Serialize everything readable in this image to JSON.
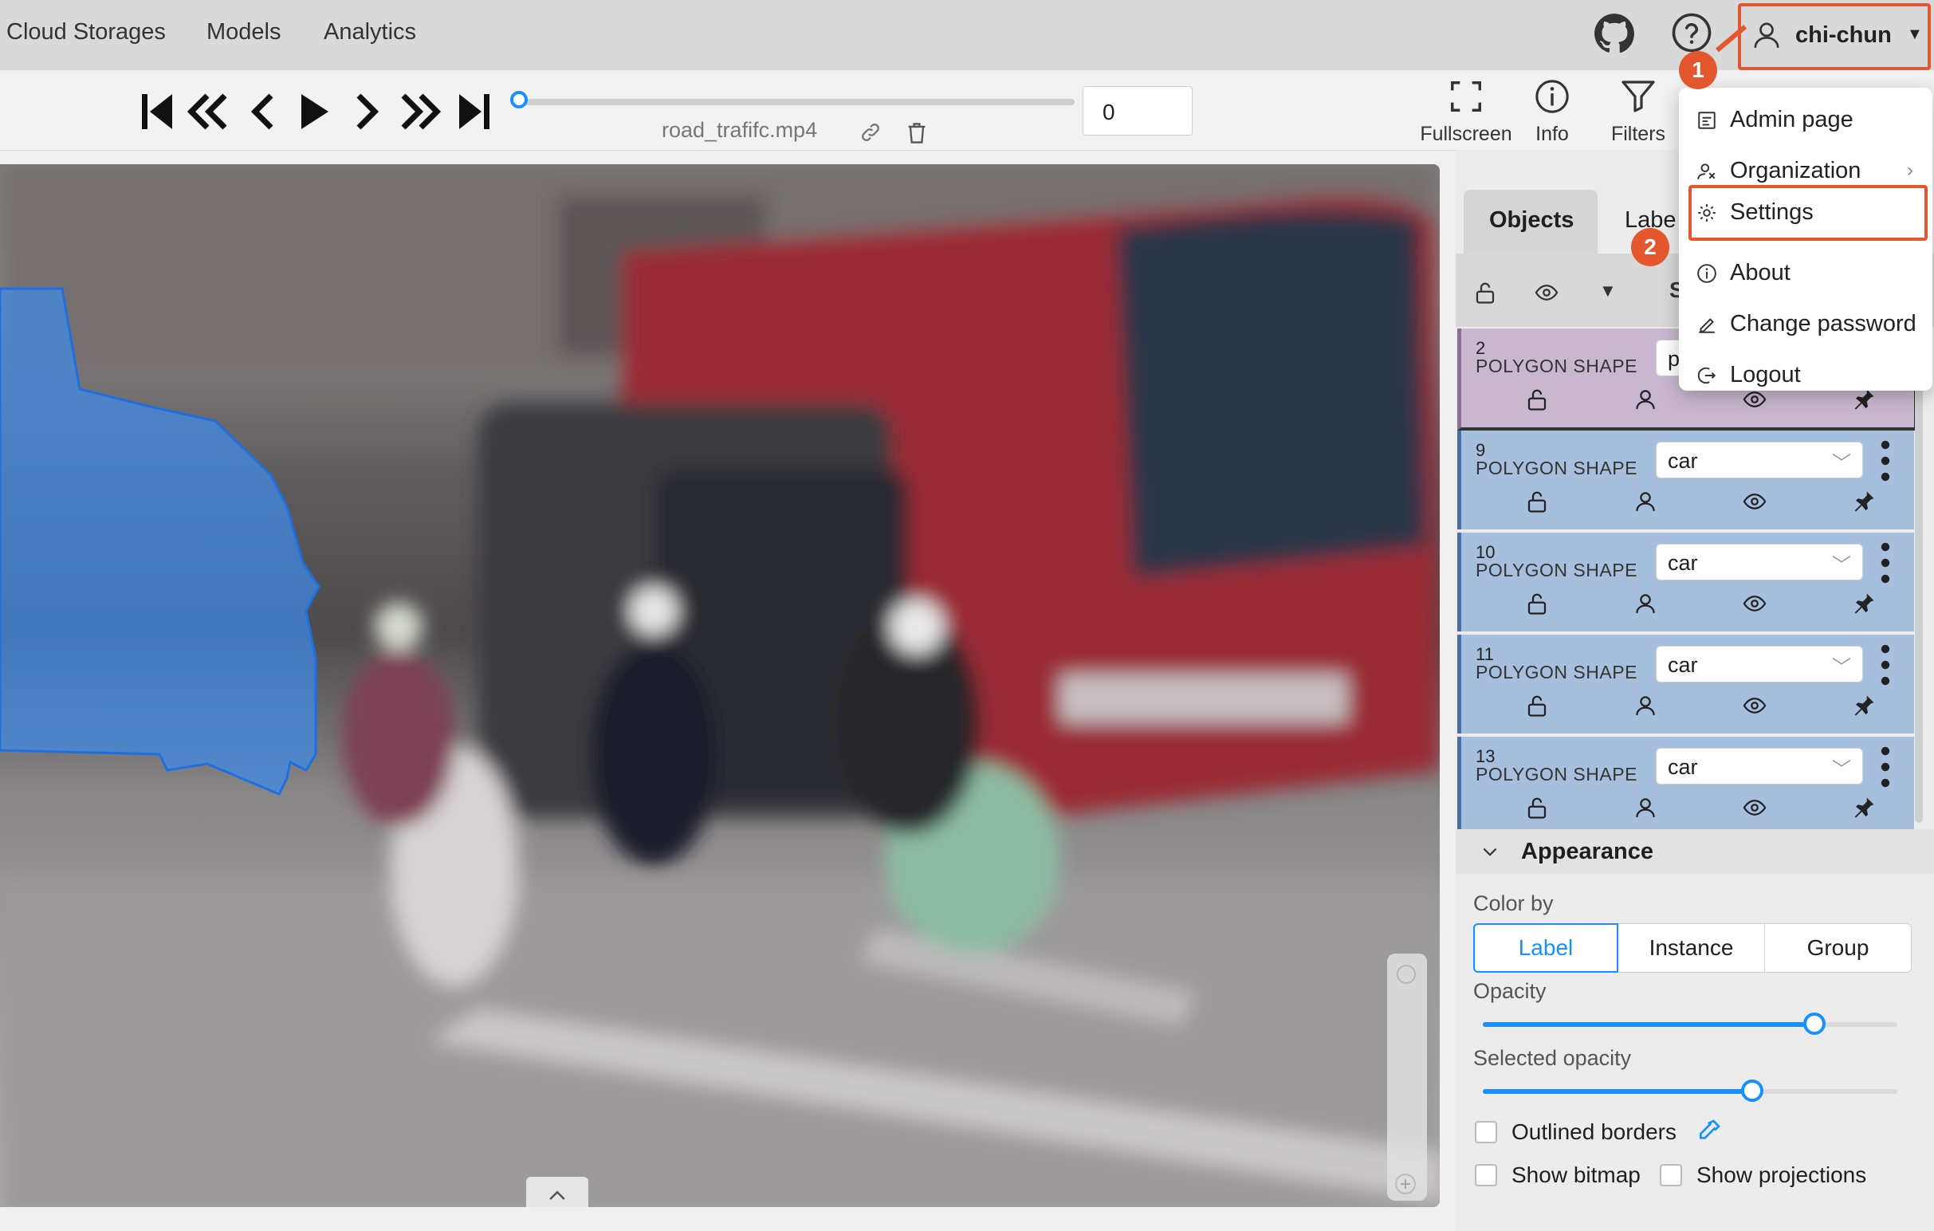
{
  "nav": {
    "links": [
      "Cloud Storages",
      "Models",
      "Analytics"
    ],
    "user": "chi-chun"
  },
  "player": {
    "filename": "road_trafifc.mp4",
    "frame": "0",
    "progress": 0.0
  },
  "toolbar": {
    "fullscreen": "Fullscreen",
    "info": "Info",
    "filters": "Filters"
  },
  "sidebar": {
    "tabs": [
      "Objects",
      "Labe"
    ],
    "header_partial": "S",
    "objects": [
      {
        "id": "2",
        "type": "POLYGON SHAPE",
        "label": "p"
      },
      {
        "id": "9",
        "type": "POLYGON SHAPE",
        "label": "car"
      },
      {
        "id": "10",
        "type": "POLYGON SHAPE",
        "label": "car"
      },
      {
        "id": "11",
        "type": "POLYGON SHAPE",
        "label": "car"
      },
      {
        "id": "13",
        "type": "POLYGON SHAPE",
        "label": "car"
      }
    ]
  },
  "appearance": {
    "title": "Appearance",
    "color_by_label": "Color by",
    "color_by_options": [
      "Label",
      "Instance",
      "Group"
    ],
    "color_by_selected": "Label",
    "opacity_label": "Opacity",
    "opacity_value": 0.8,
    "selected_opacity_label": "Selected opacity",
    "selected_opacity_value": 0.65,
    "outlined_borders": "Outlined borders",
    "show_bitmap": "Show bitmap",
    "show_projections": "Show projections"
  },
  "menu": {
    "items": [
      "Admin page",
      "Organization",
      "Settings",
      "About",
      "Change password",
      "Logout"
    ]
  },
  "badges": [
    "1",
    "2"
  ],
  "colors": {
    "accent": "#1890ff",
    "highlight": "#e4572e",
    "object_bg": "#a6bfdc",
    "selected_object_bg": "#c9b7cf"
  }
}
